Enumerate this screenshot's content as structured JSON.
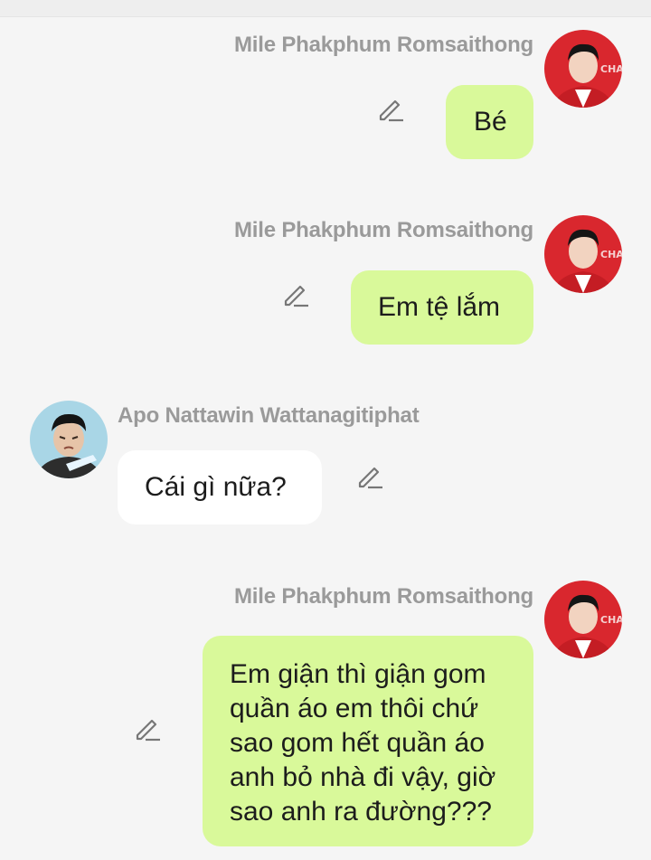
{
  "messages": [
    {
      "sender": "Mile Phakphum Romsaithong",
      "side": "right",
      "text": "Bé",
      "bubble_color": "#d9f99a"
    },
    {
      "sender": "Mile Phakphum Romsaithong",
      "side": "right",
      "text": "Em tệ lắm",
      "bubble_color": "#d9f99a"
    },
    {
      "sender": "Apo Nattawin Wattanagitiphat",
      "side": "left",
      "text": "Cái gì nữa?",
      "bubble_color": "#ffffff"
    },
    {
      "sender": "Mile Phakphum Romsaithong",
      "side": "right",
      "text": "Em giận thì giận gom\nquần áo em thôi chứ\nsao gom hết quần áo\nanh bỏ nhà đi vậy, giờ\nsao anh ra đường???",
      "bubble_color": "#d9f99a"
    }
  ],
  "icons": {
    "edit": "pencil-edit-icon",
    "avatar_mile": "avatar-mile",
    "avatar_apo": "avatar-apo"
  },
  "colors": {
    "background": "#f5f5f5",
    "sender_name": "#9a9a9a",
    "outgoing_bubble": "#d9f99a",
    "incoming_bubble": "#ffffff",
    "avatar_mile_bg": "#d9272e",
    "avatar_apo_bg": "#a9d6e6"
  }
}
